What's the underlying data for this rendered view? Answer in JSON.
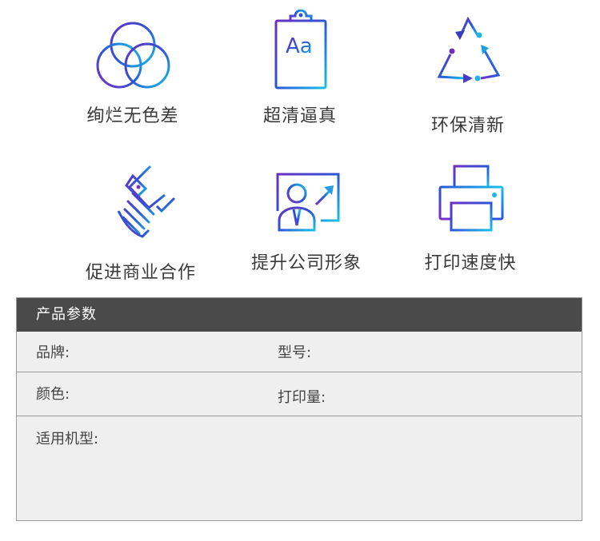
{
  "features": [
    {
      "id": "colors",
      "label": "绚烂无色差",
      "icon": "overlapping-circles-icon"
    },
    {
      "id": "clarity",
      "label": "超清逼真",
      "icon": "clipboard-text-icon"
    },
    {
      "id": "eco",
      "label": "环保清新",
      "icon": "recycle-icon"
    },
    {
      "id": "cooperation",
      "label": "促进商业合作",
      "icon": "handshake-icon"
    },
    {
      "id": "image",
      "label": "提升公司形象",
      "icon": "presentation-icon"
    },
    {
      "id": "speed",
      "label": "打印速度快",
      "icon": "printer-icon"
    }
  ],
  "params": {
    "title": "产品参数",
    "brand_label": "品牌:",
    "model_label": "型号:",
    "color_label": "颜色:",
    "print_volume_label": "打印量:",
    "compatible_label": "适用机型:"
  },
  "colors": {
    "gradient_start": "#5b2bb5",
    "gradient_mid": "#2a5fd8",
    "gradient_end": "#1fb8e6",
    "header_bg": "#4a4a4a",
    "table_bg": "#efefef"
  }
}
